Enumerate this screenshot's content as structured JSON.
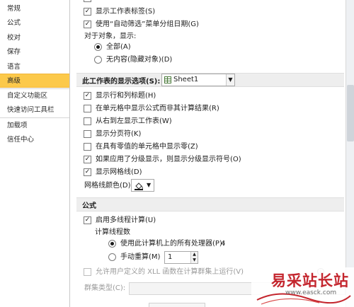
{
  "sidebar": {
    "items": [
      {
        "label": "常规"
      },
      {
        "label": "公式"
      },
      {
        "label": "校对"
      },
      {
        "label": "保存"
      },
      {
        "label": "语言"
      },
      {
        "label": "高级",
        "active": true
      },
      {
        "label": "自定义功能区"
      },
      {
        "label": "快速访问工具栏"
      },
      {
        "label": "加载项"
      },
      {
        "label": "信任中心"
      }
    ]
  },
  "workbook_options": {
    "show_sheet_tabs": {
      "label": "显示工作表标签(S)",
      "checked": true
    },
    "group_dates": {
      "label": "使用“自动筛选”菜单分组日期(G)",
      "checked": true
    },
    "for_objects_label": "对于对象，显示:",
    "objects_all": {
      "label": "全部(A)",
      "selected": true
    },
    "objects_none": {
      "label": "无内容(隐藏对象)(D)",
      "selected": false
    }
  },
  "sheet_options": {
    "section_label": "此工作表的显示选项(S):",
    "sheet_select_value": "Sheet1",
    "show_headers": {
      "label": "显示行和列标题(H)",
      "checked": true
    },
    "show_formulas": {
      "label": "在单元格中显示公式而非其计算结果(R)",
      "checked": false
    },
    "right_to_left": {
      "label": "从右到左显示工作表(W)",
      "checked": false
    },
    "show_page_breaks": {
      "label": "显示分页符(K)",
      "checked": false
    },
    "show_zero": {
      "label": "在具有零值的单元格中显示零(Z)",
      "checked": false
    },
    "show_outline": {
      "label": "如果应用了分级显示，则显示分级显示符号(O)",
      "checked": true
    },
    "show_gridlines": {
      "label": "显示网格线(D)",
      "checked": true
    },
    "gridline_color_label": "网格线颜色(D)"
  },
  "formulas": {
    "section_title": "公式",
    "multithread": {
      "label": "启用多线程计算(U)",
      "checked": true
    },
    "thread_count_label": "计算线程数",
    "use_all_processors": {
      "label": "使用此计算机上的所有处理器(P):",
      "selected": true,
      "count": "4"
    },
    "manual": {
      "label": "手动重算(M)",
      "selected": false,
      "value": "1"
    },
    "xll_cluster": {
      "label": "允许用户定义的 XLL 函数在计算群集上运行(V)",
      "checked": false,
      "info_icon": "info-icon"
    },
    "cluster_type_label": "群集类型(C):"
  },
  "watermark": {
    "title": "易采站长站",
    "url": "www.easck.com"
  },
  "colors": {
    "active_nav": "#fcc94a",
    "watermark_red": "#c4262e"
  }
}
